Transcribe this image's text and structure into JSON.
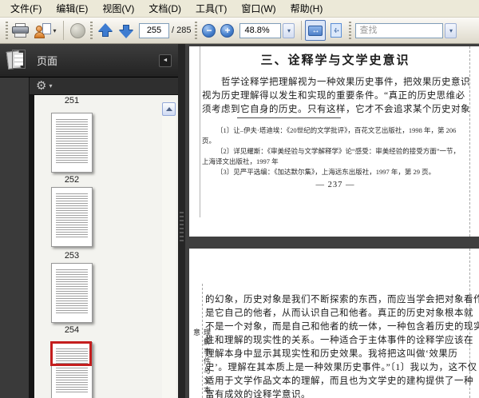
{
  "menu_bar": {
    "items": [
      {
        "label": "文件(F)"
      },
      {
        "label": "编辑(E)"
      },
      {
        "label": "视图(V)"
      },
      {
        "label": "文档(D)"
      },
      {
        "label": "工具(T)"
      },
      {
        "label": "窗口(W)"
      },
      {
        "label": "帮助(H)"
      }
    ]
  },
  "toolbar": {
    "page_input": "255",
    "page_total": "/ 285",
    "zoom_value": "48.8%",
    "find_placeholder": "查找",
    "icons": {
      "dropdown_glyph": "▾",
      "minus_glyph": "−",
      "plus_glyph": "+",
      "h_arrows_glyph": "↔"
    }
  },
  "sidebar": {
    "panel_title": "页面",
    "collapse_glyph": "◄",
    "gear_glyph": "⚙",
    "gear_caret_glyph": "▾",
    "items": [
      {
        "label": "251",
        "has_thumb": false
      },
      {
        "label": "252",
        "has_thumb": true
      },
      {
        "label": "253",
        "has_thumb": true
      },
      {
        "label": "254",
        "has_thumb": true
      },
      {
        "label": "",
        "has_thumb": true,
        "current": true
      }
    ]
  },
  "document": {
    "page_top": {
      "title": "三、诠释学与文学史意识",
      "body_lines": [
        "哲学诠释学把理解视为一种效果历史事件，把效果历史意识",
        "视为历史理解得以发生和实现的重要条件。“真正的历史思维必",
        "须考虑到它自身的历史。只有这样，它才不会追求某个历史对象"
      ],
      "footnote_lines": [
        "〔1〕让–伊夫·塔迪埃：《20世纪的文学批评》，百花文艺出版社，1998 年，第 206",
        "页。",
        "〔2〕详见耀斯：《审美经验与文学解释学》论“感受：审美经验的接受方面”一节，",
        "上海译文出版社，1997 年",
        "〔3〕见严平选编：《加达默尔集》，上海远东出版社，1997 年，第 29 页。"
      ],
      "page_number": "— 237 —"
    },
    "page_bottom": {
      "margin_title": "理解事件与文本意",
      "body_lines": [
        "的幻象，历史对象是我们不断探索的东西，而应当学会把对象看作",
        "是它自己的他者，从而认识自己和他者。真正的历史对象根本就",
        "不是一个对象，而是自己和他者的统一体，一种包含着历史的现实",
        "性和理解的现实性的关系。一种适合于主体事件的诠释学应该在",
        "理解本身中显示其现实性和历史效果。我将把这叫做‘效果历",
        "史’。理解在其本质上是一种效果历史事件。”〔1〕我以为，这不仅",
        "适用于文学作品文本的理解，而且也为文学史的建构提供了一种",
        "富有成效的诠释学意识。"
      ]
    }
  },
  "colors": {
    "accent_blue": "#3e7cd0",
    "highlight_red": "#c41e1e",
    "sidebar_dark": "#2f2f2f",
    "toolbar_bg": "#e6e2d4"
  }
}
